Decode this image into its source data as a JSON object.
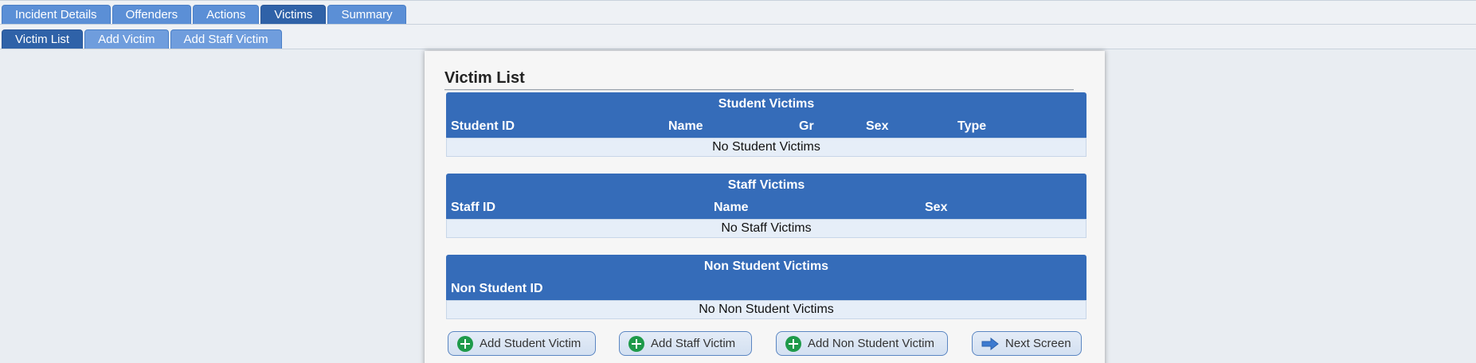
{
  "tabs_main": [
    {
      "label": "Incident Details",
      "active": false
    },
    {
      "label": "Offenders",
      "active": false
    },
    {
      "label": "Actions",
      "active": false
    },
    {
      "label": "Victims",
      "active": true
    },
    {
      "label": "Summary",
      "active": false
    }
  ],
  "tabs_sub": [
    {
      "label": "Victim List",
      "active": true
    },
    {
      "label": "Add Victim",
      "active": false
    },
    {
      "label": "Add Staff Victim",
      "active": false
    }
  ],
  "panel": {
    "title": "Victim List",
    "student": {
      "caption": "Student Victims",
      "columns": [
        "Student ID",
        "Name",
        "Gr",
        "Sex",
        "Type"
      ],
      "empty": "No Student Victims"
    },
    "staff": {
      "caption": "Staff Victims",
      "columns": [
        "Staff ID",
        "Name",
        "Sex"
      ],
      "empty": "No Staff Victims"
    },
    "nonstudent": {
      "caption": "Non Student Victims",
      "columns": [
        "Non Student ID"
      ],
      "empty": "No Non Student Victims"
    },
    "buttons": {
      "add_student": "Add Student Victim",
      "add_staff": "Add Staff Victim",
      "add_nonstudent": "Add Non Student Victim",
      "next": "Next Screen"
    }
  },
  "colors": {
    "header_blue": "#356cb9",
    "active_tab": "#2f62a8",
    "tab": "#5b8fd6",
    "plus_green": "#1e9a4a"
  }
}
